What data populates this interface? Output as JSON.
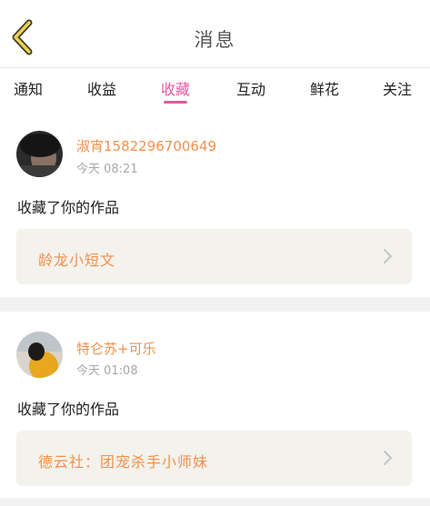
{
  "header": {
    "title": "消息",
    "back_icon": "chevron-left-icon",
    "back_color": "#c9a227"
  },
  "tabs": [
    {
      "label": "通知",
      "active": false
    },
    {
      "label": "收益",
      "active": false
    },
    {
      "label": "收藏",
      "active": true
    },
    {
      "label": "互动",
      "active": false
    },
    {
      "label": "鲜花",
      "active": false
    },
    {
      "label": "关注",
      "active": false
    }
  ],
  "colors": {
    "accent": "#e25a9d",
    "name": "#f2904d",
    "work_bg": "#f3f2ec"
  },
  "messages": [
    {
      "user_name": "淑宵1582296700649",
      "time": "今天 08:21",
      "action": "收藏了你的作品",
      "work_title": "龄龙小短文"
    },
    {
      "user_name": "特仑苏+可乐",
      "time": "今天 01:08",
      "action": "收藏了你的作品",
      "work_title": "德云社：团宠杀手小师妹"
    }
  ]
}
